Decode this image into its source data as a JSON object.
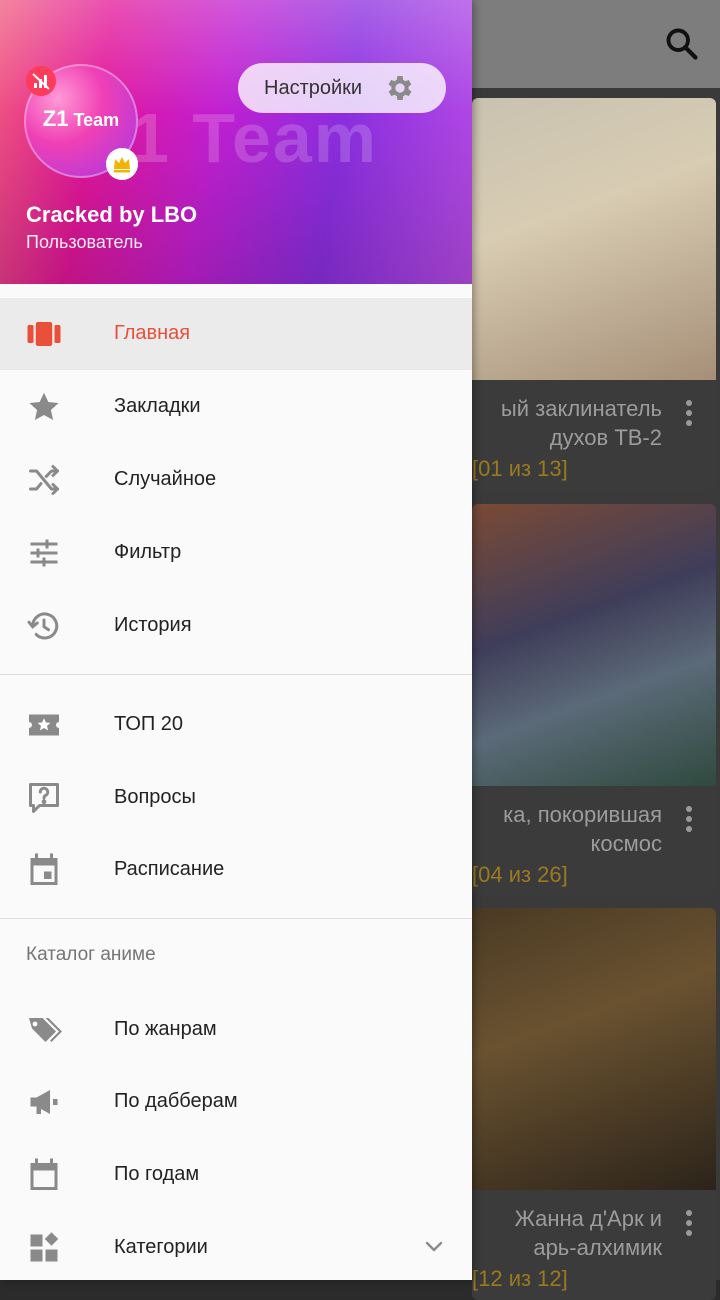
{
  "background": {
    "cards": [
      {
        "title": "ый заклинатель\nдухов ТВ-2",
        "episodes": "[01 из 13]"
      },
      {
        "title": "ка, покорившая\nкосмос",
        "episodes": "[04 из 26]"
      },
      {
        "title": "Жанна д'Арк и\nарь-алхимик",
        "episodes": "[12 из 12]"
      }
    ]
  },
  "header": {
    "avatar_text_line1": "Z1",
    "avatar_text_line2": "Team",
    "settings_label": "Настройки",
    "user_name": "Cracked by LBO",
    "user_role": "Пользователь"
  },
  "nav": {
    "main": [
      {
        "label": "Главная",
        "icon": "home-cards-icon",
        "active": true
      },
      {
        "label": "Закладки",
        "icon": "star-icon"
      },
      {
        "label": "Случайное",
        "icon": "shuffle-icon"
      },
      {
        "label": "Фильтр",
        "icon": "tune-icon"
      },
      {
        "label": "История",
        "icon": "history-icon"
      }
    ],
    "secondary": [
      {
        "label": "ТОП 20",
        "icon": "ticket-star-icon"
      },
      {
        "label": "Вопросы",
        "icon": "question-icon"
      },
      {
        "label": "Расписание",
        "icon": "calendar-event-icon"
      }
    ],
    "catalog_label": "Каталог аниме",
    "catalog": [
      {
        "label": "По жанрам",
        "icon": "tags-icon"
      },
      {
        "label": "По дабберам",
        "icon": "megaphone-icon"
      },
      {
        "label": "По годам",
        "icon": "calendar-icon"
      },
      {
        "label": "Категории",
        "icon": "widgets-icon"
      }
    ]
  },
  "colors": {
    "accent": "#e8503a",
    "icon_gray": "#8a8a8a"
  }
}
